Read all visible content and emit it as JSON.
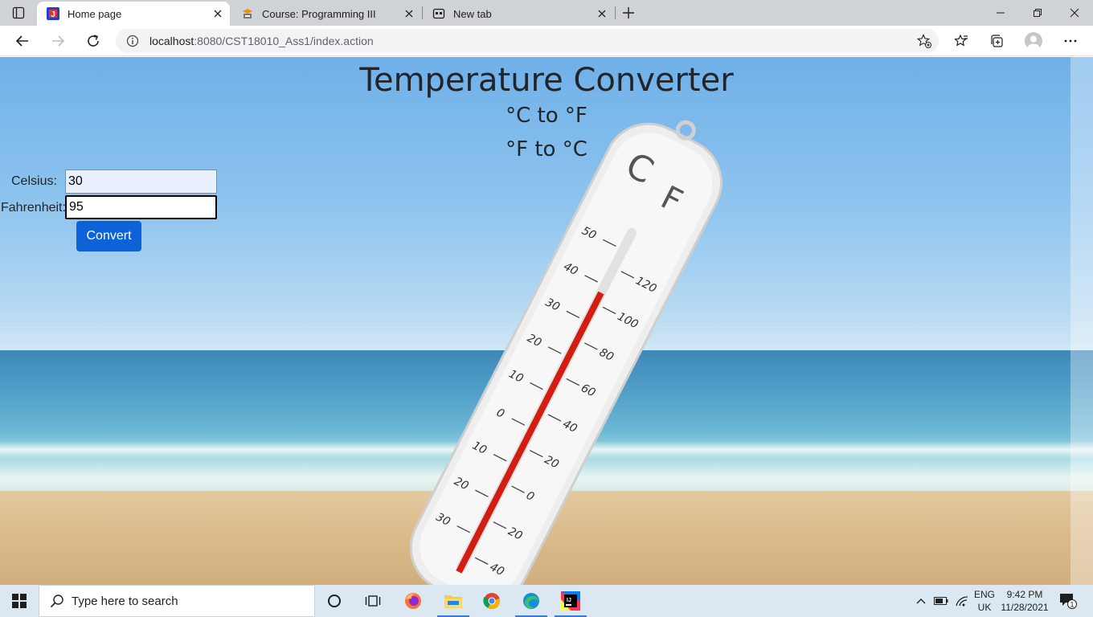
{
  "browser": {
    "tabs": [
      {
        "title": "Home page",
        "active": true
      },
      {
        "title": "Course: Programming III",
        "active": false
      },
      {
        "title": "New tab",
        "active": false
      }
    ],
    "url_host": "localhost",
    "url_path": ":8080/CST18010_Ass1/index.action"
  },
  "page": {
    "title": "Temperature Converter",
    "subtitle_1": "°C to °F",
    "subtitle_2": "°F to °C",
    "celsius_label": "Celsius:",
    "celsius_value": "30",
    "fahrenheit_label": "Fahrenheit:",
    "fahrenheit_value": "95",
    "convert_label": "Convert"
  },
  "taskbar": {
    "search_placeholder": "Type here to search",
    "language_line1": "ENG",
    "language_line2": "UK",
    "time": "9:42 PM",
    "date": "11/28/2021",
    "notification_count": "1"
  },
  "colors": {
    "primary_button": "#0d62d7",
    "autofill_bg": "#e8f0fe",
    "tab_strip": "#cfd2d6",
    "taskbar": "#dce8f1"
  },
  "icons": [
    "tab-actions-icon",
    "jsp-favicon",
    "moodle-favicon",
    "newtab-favicon",
    "close-icon",
    "plus-icon",
    "minimize-icon",
    "restore-icon",
    "back-icon",
    "forward-icon",
    "refresh-icon",
    "info-icon",
    "add-favorite-icon",
    "favorites-icon",
    "collections-icon",
    "profile-avatar",
    "more-icon",
    "windows-start-icon",
    "search-icon",
    "cortana-icon",
    "task-view-icon",
    "firefox-icon",
    "file-explorer-icon",
    "chrome-icon",
    "edge-icon",
    "intellij-icon",
    "chevron-up-icon",
    "battery-icon",
    "wifi-icon",
    "notification-icon"
  ]
}
